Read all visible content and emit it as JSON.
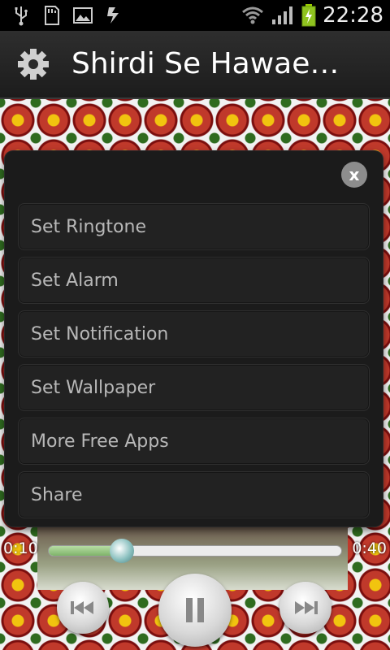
{
  "status_bar": {
    "icons": [
      "usb-icon",
      "sd-card-icon",
      "image-icon",
      "sync-icon"
    ],
    "right_icons": [
      "wifi-icon",
      "signal-icon",
      "battery-charging-icon"
    ],
    "time": "22:28"
  },
  "app_bar": {
    "icon": "gear-icon",
    "title": "Shirdi Se Hawae…"
  },
  "dialog": {
    "close_label": "x",
    "items": [
      {
        "label": "Set Ringtone"
      },
      {
        "label": "Set Alarm"
      },
      {
        "label": "Set Notification"
      },
      {
        "label": "Set Wallpaper"
      },
      {
        "label": "More Free Apps"
      },
      {
        "label": "Share"
      }
    ]
  },
  "player": {
    "elapsed": "0:10",
    "duration": "0:40",
    "progress": 0.25,
    "controls": [
      "previous-icon",
      "pause-icon",
      "next-icon"
    ]
  },
  "colors": {
    "accent_progress": "#7fb36a",
    "dialog_bg": "#1b1b1b",
    "menu_text": "#b8b8b8"
  }
}
